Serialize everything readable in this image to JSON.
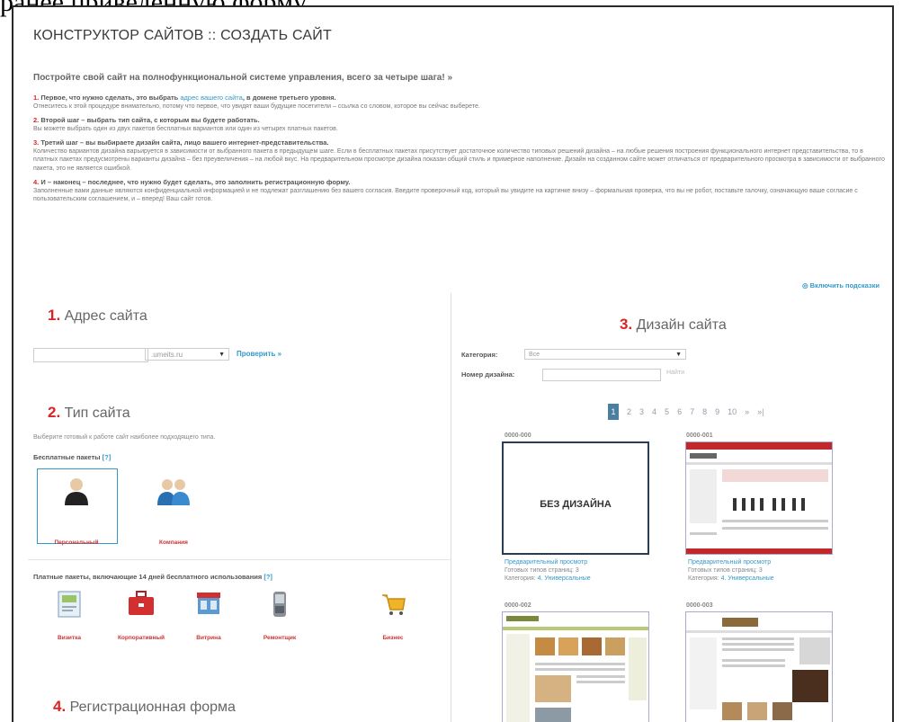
{
  "caption": "ранее приведенную форму.",
  "page": {
    "title": "КОНСТРУКТОР САЙТОВ :: СОЗДАТЬ САЙТ",
    "intro": "Постройте свой сайт на полнофункциональной системе управления, всего за четыре шага! »",
    "steps": [
      {
        "num": "1.",
        "head": " Первое, что нужно сделать, это выбрать ",
        "link": "адрес вашего сайта",
        "tail": ", в домене третьего уровня.",
        "body": "Отнеситесь к этой процедуре внимательно, потому что первое, что увидят ваши будущие посетители – ссылка со словом, которое вы сейчас выберете."
      },
      {
        "num": "2.",
        "head": " Второй шаг – выбрать тип сайта, с которым вы будете работать.",
        "link": "",
        "tail": "",
        "body": "Вы можете выбрать один из двух пакетов бесплатных вариантов или один из четырех платных пакетов."
      },
      {
        "num": "3.",
        "head": " Третий шаг – вы выбираете дизайн сайта, лицо вашего интернет-представительства.",
        "link": "",
        "tail": "",
        "body": "Количество вариантов дизайна варьируется в зависимости от выбранного пакета в предыдущем шаге. Если в бесплатных пакетах присутствует достаточное количество типовых решений дизайна – на любые решения построения функционального интернет представительства, то в платных пакетах предусмотрены варианты дизайна – без преувеличения – на любой вкус. На предварительном просмотре дизайна показан общий стиль и примерное наполнение. Дизайн на созданном сайте может отличаться от предварительного просмотра в зависимости от выбранного пакета, это не является ошибкой."
      },
      {
        "num": "4.",
        "head": " И – наконец – последнее, что нужно будет сделать, это заполнить регистрационную форму.",
        "link": "",
        "tail": "",
        "body": "Заполненные вами данные являются конфиденциальной информацией и не подлежат разглашению без вашего согласия. Введите проверочный код, который вы увидите на картинке внизу – формальная проверка, что вы не робот, поставьте галочку, означающую ваше согласие с пользовательским соглашением, и – вперед! Ваш сайт готов."
      }
    ],
    "help_link": "◎ Включить подсказки"
  },
  "left": {
    "sec1": {
      "num": "1.",
      "label": " Адрес сайта"
    },
    "domain": ".umeits.ru",
    "check": "Проверить »",
    "sec2": {
      "num": "2.",
      "label": " Тип сайта"
    },
    "type_hint": "Выберите готовый к работе сайт наиболее подходящего типа.",
    "free_head": "Бесплатные пакеты",
    "help_q": "[?]",
    "free": [
      "Персональный",
      "Компания"
    ],
    "paid_head": "Платные пакеты, включающие 14 дней бесплатного использования",
    "paid": [
      "Визитка",
      "Корпоративный",
      "Витрина",
      "Ремонтщик",
      "Бизнес"
    ],
    "sec4": {
      "num": "4.",
      "label": " Регистрационная форма"
    }
  },
  "right": {
    "sec3": {
      "num": "3.",
      "label": " Дизайн сайта"
    },
    "cat_label": "Категория:",
    "cat_value": "Все",
    "num_label": "Номер дизайна:",
    "find": "Найти",
    "pages": [
      "1",
      "2",
      "3",
      "4",
      "5",
      "6",
      "7",
      "8",
      "9",
      "10",
      "»",
      "»|"
    ],
    "designs": [
      {
        "code": "0000-000",
        "preview": "Предварительный просмотр",
        "pages": "Готовых типов страниц: ",
        "pages_n": "3",
        "cat": "Категория: ",
        "cat_v": "4. Универсальные"
      },
      {
        "code": "0000-001",
        "preview": "Предварительный просмотр",
        "pages": "Готовых типов страниц: ",
        "pages_n": "3",
        "cat": "Категория: ",
        "cat_v": "4. Универсальные"
      },
      {
        "code": "0000-002"
      },
      {
        "code": "0000-003"
      }
    ],
    "no_design": "БЕЗ ДИЗАЙНА"
  }
}
